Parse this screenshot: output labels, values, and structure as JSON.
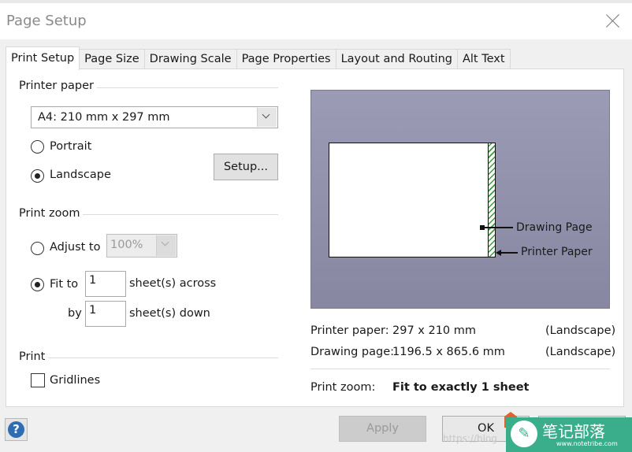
{
  "window": {
    "title": "Page Setup",
    "close_icon": "close-icon"
  },
  "tabs": [
    {
      "label": "Print Setup",
      "active": true
    },
    {
      "label": "Page Size",
      "active": false
    },
    {
      "label": "Drawing Scale",
      "active": false
    },
    {
      "label": "Page Properties",
      "active": false
    },
    {
      "label": "Layout and Routing",
      "active": false
    },
    {
      "label": "Alt Text",
      "active": false
    }
  ],
  "printer_paper": {
    "group_label": "Printer paper",
    "size_selected": "A4:  210 mm x 297 mm",
    "orientation_options": [
      {
        "label": "Portrait",
        "checked": false
      },
      {
        "label": "Landscape",
        "checked": true
      }
    ],
    "setup_button": "Setup..."
  },
  "print_zoom": {
    "group_label": "Print zoom",
    "adjust_to_label": "Adjust to",
    "adjust_to_checked": false,
    "adjust_to_value": "100%",
    "fit_to_label": "Fit to",
    "fit_to_checked": true,
    "across_value": "1",
    "across_label": "sheet(s) across",
    "by_label": "by",
    "down_value": "1",
    "down_label": "sheet(s) down"
  },
  "print": {
    "group_label": "Print",
    "gridlines_label": "Gridlines",
    "gridlines_checked": false
  },
  "preview": {
    "drawing_page_label": "Drawing Page",
    "printer_paper_label": "Printer Paper",
    "colors": {
      "background": "#9393ad",
      "hatch": "#3a9b3a"
    }
  },
  "info": {
    "printer_paper_label": "Printer paper:",
    "printer_paper_value": "297 x 210 mm",
    "printer_paper_orientation": "(Landscape)",
    "drawing_page_label": "Drawing page:",
    "drawing_page_value": "1196.5 x 865.6 mm",
    "drawing_page_orientation": "(Landscape)",
    "print_zoom_label": "Print zoom:",
    "print_zoom_value": "Fit to exactly 1 sheet"
  },
  "footer": {
    "help_icon": "?",
    "apply_label": "Apply",
    "ok_label": "OK"
  },
  "watermark": {
    "icon": "✎",
    "text": "笔记部落",
    "sub": "www.notetribe.com",
    "url": "https://blog"
  }
}
